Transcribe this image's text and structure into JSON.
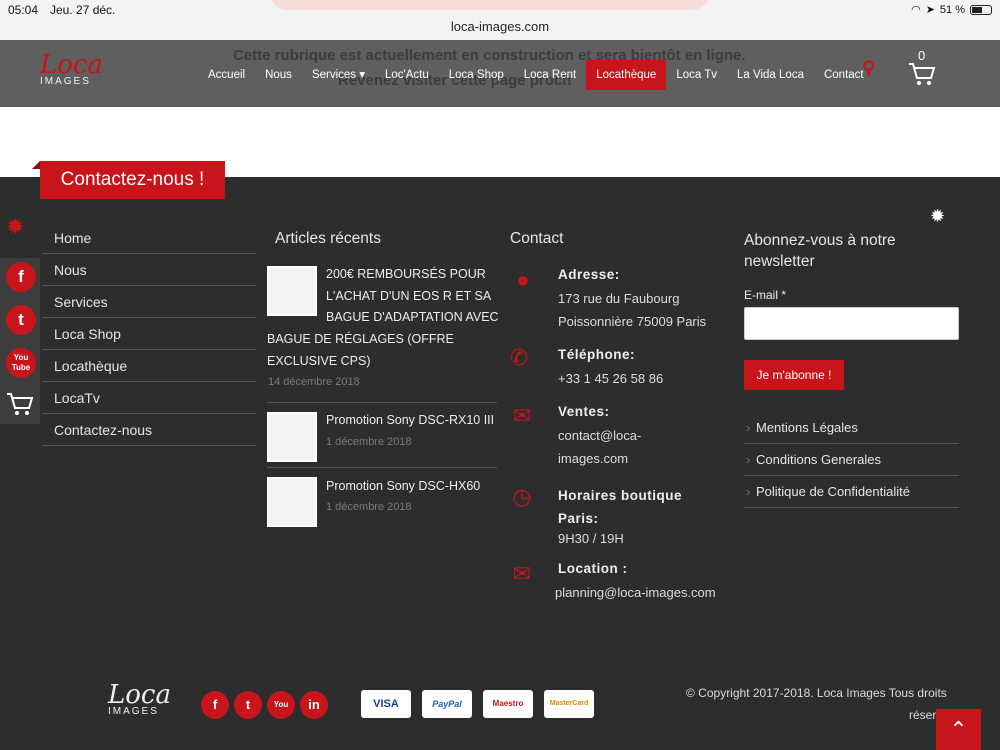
{
  "status": {
    "time": "05:04",
    "date": "Jeu. 27 déc.",
    "url": "loca-images.com",
    "battery": "51 %"
  },
  "banner": {
    "line1": "Cette rubrique est actuellement en construction et sera bientôt en ligne.",
    "line2": "Revenez visiter cette page proch"
  },
  "logo": {
    "main": "Loca",
    "sub": "IMAGES"
  },
  "nav": {
    "items": [
      "Accueil",
      "Nous",
      "Services ▾",
      "Loc'Actu",
      "Loca Shop",
      "Loca Rent",
      "Locathèque",
      "Loca Tv",
      "La Vida Loca",
      "Contact"
    ],
    "active_index": 6,
    "cart_count": "0"
  },
  "contact_heading": "Contactez-nous !",
  "side_social": [
    "f",
    "t",
    "You Tube"
  ],
  "menu": [
    "Home",
    "Nous",
    "Services",
    "Loca Shop",
    "Locathèque",
    "LocaTv",
    "Contactez-nous"
  ],
  "articles": {
    "title": "Articles récents",
    "posts": [
      {
        "title_lines": [
          "200€ REMBOURSÉS POUR",
          "L'ACHAT D'UN EOS R ET SA",
          "BAGUE D'ADAPTATION AVEC",
          "BAGUE DE RÉGLAGES (OFFRE",
          "EXCLUSIVE CPS)"
        ],
        "date": "14 décembre 2018"
      },
      {
        "title_lines": [
          "Promotion Sony DSC-RX10 III"
        ],
        "date": "1 décembre 2018"
      },
      {
        "title_lines": [
          "Promotion Sony DSC-HX60"
        ],
        "date": "1 décembre 2018"
      }
    ]
  },
  "contact": {
    "title": "Contact",
    "blocks": [
      {
        "label": "Adresse:",
        "value": [
          "173 rue du Faubourg",
          "Poissonnière 75009 Paris"
        ]
      },
      {
        "label": "Téléphone:",
        "value": [
          "+33 1 45 26 58 86"
        ]
      },
      {
        "label": "Ventes:",
        "value": [
          "contact@loca-",
          "images.com"
        ]
      },
      {
        "label": "Horaires boutique",
        "label2": "Paris:",
        "value": [
          "9H30 / 19H"
        ]
      },
      {
        "label": "Location :",
        "value": [
          "planning@loca-images.com"
        ]
      }
    ]
  },
  "newsletter": {
    "title_lines": [
      "Abonnez-vous à notre",
      "newsletter"
    ],
    "email_label": "E-mail",
    "required": "*",
    "button": "Je m'abonne !",
    "links": [
      "Mentions Légales",
      "Conditions Generales",
      "Politique de Confidentialité"
    ]
  },
  "footer": {
    "social": [
      "f",
      "t",
      "You",
      "in"
    ],
    "cards": [
      "VISA",
      "PayPal",
      "Maestro",
      "MasterCard"
    ],
    "copyright": "© Copyright 2017-2018. Loca Images Tous droits",
    "copyright2": "réser"
  }
}
